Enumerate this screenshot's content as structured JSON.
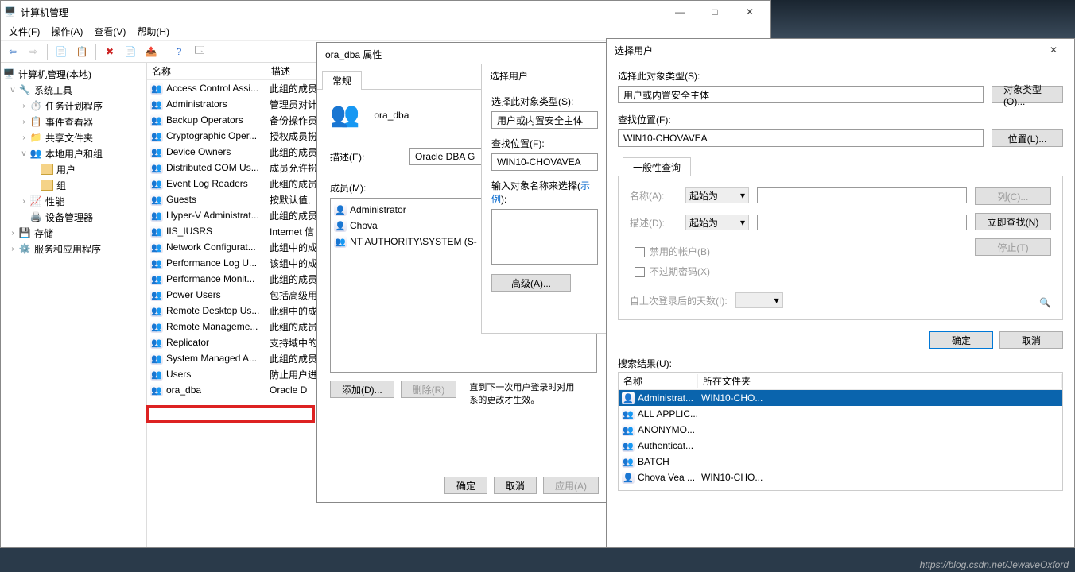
{
  "mmc": {
    "title": "计算机管理",
    "menus": [
      "文件(F)",
      "操作(A)",
      "查看(V)",
      "帮助(H)"
    ],
    "tree": {
      "root": "计算机管理(本地)",
      "sys_tools": "系统工具",
      "task_scheduler": "任务计划程序",
      "event_viewer": "事件查看器",
      "shared_folders": "共享文件夹",
      "local_users": "本地用户和组",
      "users": "用户",
      "groups": "组",
      "performance": "性能",
      "device_mgr": "设备管理器",
      "storage": "存储",
      "services_apps": "服务和应用程序"
    },
    "cols": {
      "name": "名称",
      "desc": "描述"
    },
    "groups": [
      {
        "n": "Access Control Assi...",
        "d": "此组的成员"
      },
      {
        "n": "Administrators",
        "d": "管理员对计"
      },
      {
        "n": "Backup Operators",
        "d": "备份操作员"
      },
      {
        "n": "Cryptographic Oper...",
        "d": "授权成员扮"
      },
      {
        "n": "Device Owners",
        "d": "此组的成员"
      },
      {
        "n": "Distributed COM Us...",
        "d": "成员允许扮"
      },
      {
        "n": "Event Log Readers",
        "d": "此组的成员"
      },
      {
        "n": "Guests",
        "d": "按默认值,"
      },
      {
        "n": "Hyper-V Administrat...",
        "d": "此组的成员"
      },
      {
        "n": "IIS_IUSRS",
        "d": "Internet 信"
      },
      {
        "n": "Network Configurat...",
        "d": "此组中的成"
      },
      {
        "n": "Performance Log U...",
        "d": "该组中的成"
      },
      {
        "n": "Performance Monit...",
        "d": "此组的成员"
      },
      {
        "n": "Power Users",
        "d": "包括高级用"
      },
      {
        "n": "Remote Desktop Us...",
        "d": "此组中的成"
      },
      {
        "n": "Remote Manageme...",
        "d": "此组的成员"
      },
      {
        "n": "Replicator",
        "d": "支持域中的"
      },
      {
        "n": "System Managed A...",
        "d": "此组的成员"
      },
      {
        "n": "Users",
        "d": "防止用户进"
      },
      {
        "n": "ora_dba",
        "d": "Oracle D"
      }
    ]
  },
  "props": {
    "title": "ora_dba 属性",
    "tab": "常规",
    "group_name": "ora_dba",
    "desc_label": "描述(E):",
    "desc_value": "Oracle DBA G",
    "members_label": "成员(M):",
    "members": [
      "Administrator",
      "Chova",
      "NT AUTHORITY\\SYSTEM (S-"
    ],
    "note": "直到下一次用户登录时对用\n系的更改才生效。",
    "add": "添加(D)...",
    "remove": "删除(R)",
    "ok": "确定",
    "cancel": "取消",
    "apply": "应用(A)"
  },
  "sel1": {
    "title": "选择用户",
    "type_label": "选择此对象类型(S):",
    "type_value": "用户或内置安全主体",
    "loc_label": "查找位置(F):",
    "loc_value": "WIN10-CHOVAVEA",
    "enter_label_a": "输入对象名称来选择(",
    "enter_label_link": "示例",
    "enter_label_b": "):",
    "advanced": "高级(A)..."
  },
  "sel2": {
    "title": "选择用户",
    "type_label": "选择此对象类型(S):",
    "type_value": "用户或内置安全主体",
    "obj_types_btn": "对象类型(O)...",
    "loc_label": "查找位置(F):",
    "loc_value": "WIN10-CHOVAVEA",
    "loc_btn": "位置(L)...",
    "general_tab": "一般性查询",
    "name_label": "名称(A):",
    "desc_label": "描述(D):",
    "combo": "起始为",
    "chk_disabled": "禁用的帐户(B)",
    "chk_pwd": "不过期密码(X)",
    "days_label": "自上次登录后的天数(I):",
    "cols_btn": "列(C)...",
    "find_now": "立即查找(N)",
    "stop": "停止(T)",
    "ok": "确定",
    "cancel": "取消",
    "results_label": "搜索结果(U):",
    "res_cols": {
      "name": "名称",
      "folder": "所在文件夹"
    },
    "results": [
      {
        "n": "Administrat...",
        "f": "WIN10-CHO...",
        "sel": true,
        "icon": "user"
      },
      {
        "n": "ALL APPLIC...",
        "f": "",
        "icon": "group"
      },
      {
        "n": "ANONYMO...",
        "f": "",
        "icon": "group"
      },
      {
        "n": "Authenticat...",
        "f": "",
        "icon": "group"
      },
      {
        "n": "BATCH",
        "f": "",
        "icon": "group"
      },
      {
        "n": "Chova Vea ...",
        "f": "WIN10-CHO...",
        "icon": "user"
      }
    ]
  },
  "watermark": "https://blog.csdn.net/JewaveOxford"
}
